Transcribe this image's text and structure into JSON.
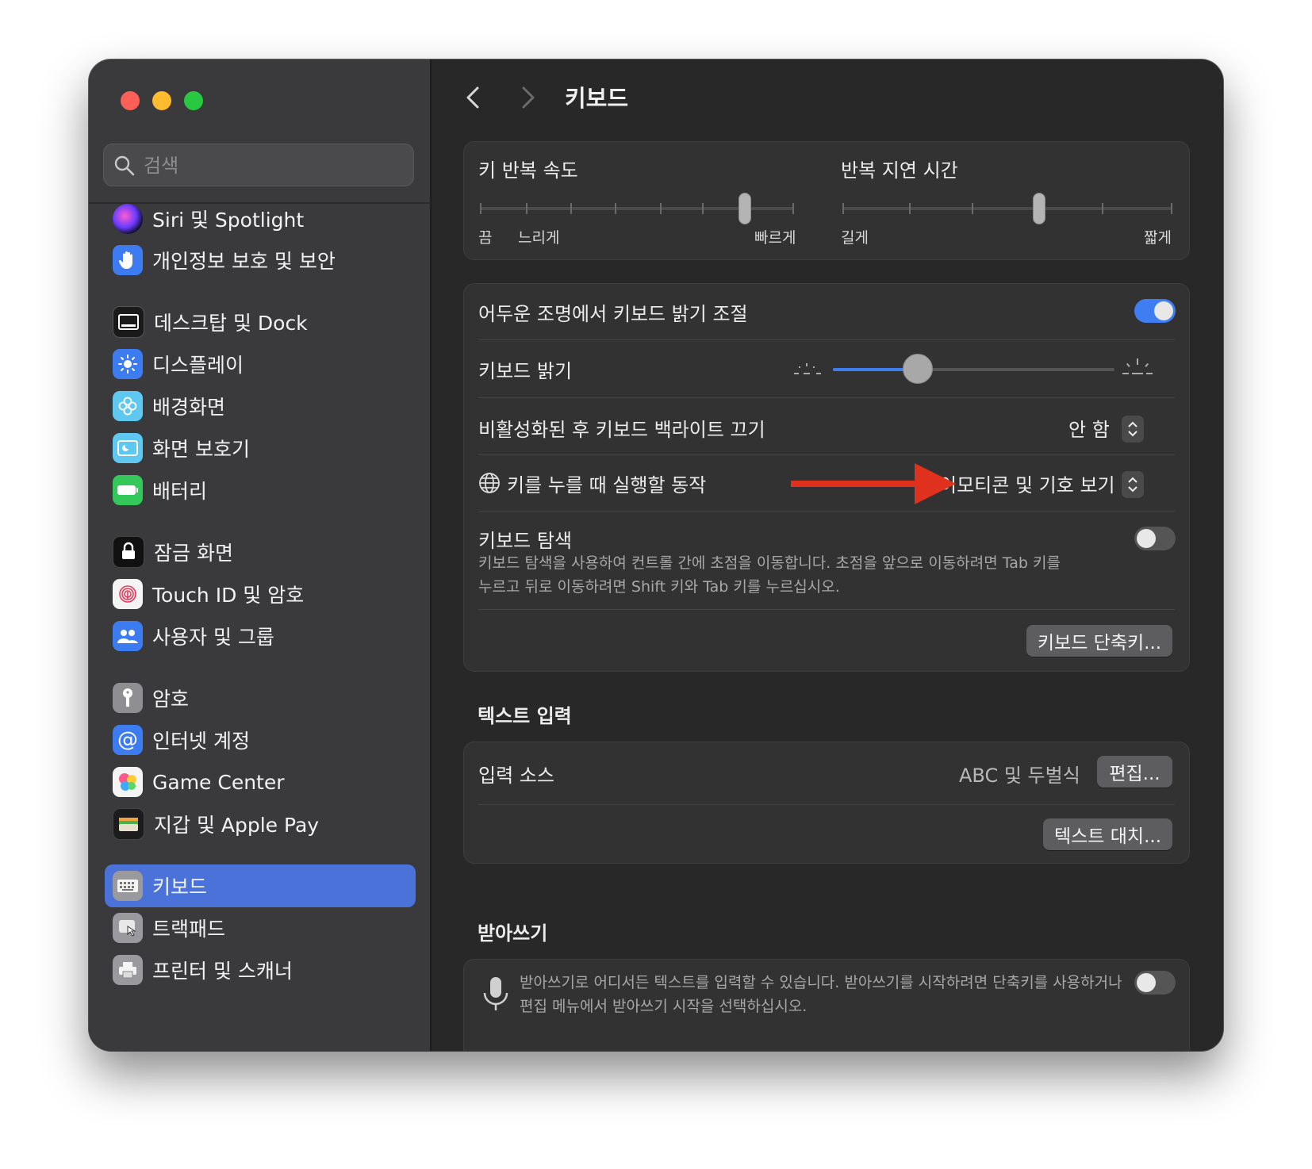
{
  "sidebar": {
    "search_placeholder": "검색",
    "items": [
      {
        "label": "Siri 및 Spotlight",
        "icon": "siri-icon"
      },
      {
        "label": "개인정보 보호 및 보안",
        "icon": "hand-icon"
      },
      {
        "label": "데스크탑 및 Dock",
        "icon": "dock-icon"
      },
      {
        "label": "디스플레이",
        "icon": "sun-icon"
      },
      {
        "label": "배경화면",
        "icon": "flower-icon"
      },
      {
        "label": "화면 보호기",
        "icon": "screensaver-icon"
      },
      {
        "label": "배터리",
        "icon": "battery-icon"
      },
      {
        "label": "잠금 화면",
        "icon": "lock-icon"
      },
      {
        "label": "Touch ID 및 암호",
        "icon": "fingerprint-icon"
      },
      {
        "label": "사용자 및 그룹",
        "icon": "users-icon"
      },
      {
        "label": "암호",
        "icon": "key-icon"
      },
      {
        "label": "인터넷 계정",
        "icon": "at-icon"
      },
      {
        "label": "Game Center",
        "icon": "game-center-icon"
      },
      {
        "label": "지갑 및 Apple Pay",
        "icon": "wallet-icon"
      },
      {
        "label": "키보드",
        "icon": "keyboard-icon",
        "selected": true
      },
      {
        "label": "트랙패드",
        "icon": "trackpad-icon"
      },
      {
        "label": "프린터 및 스캐너",
        "icon": "printer-icon"
      }
    ]
  },
  "header": {
    "title": "키보드"
  },
  "repeat": {
    "key_repeat_rate": {
      "title": "키 반복 속도",
      "left1": "끔",
      "left2": "느리게",
      "right": "빠르게",
      "value_fraction": 0.85
    },
    "repeat_delay": {
      "title": "반복 지연 시간",
      "left": "길게",
      "right": "짧게",
      "value_fraction": 0.6
    }
  },
  "keyboard": {
    "adjust_brightness_label": "어두운 조명에서 키보드 밝기 조절",
    "adjust_brightness_on": true,
    "brightness_label": "키보드 밝기",
    "brightness_fraction": 0.3,
    "backlight_off_label": "비활성화된 후 키보드 백라이트 끄기",
    "backlight_off_value": "안 함",
    "globe_key_label": "키를 누를 때 실행할 동작",
    "globe_key_value": "이모티콘 및 기호 보기",
    "navigation_label": "키보드 탐색",
    "navigation_desc_line1": "키보드 탐색을 사용하여 컨트롤 간에 초점을 이동합니다. 초점을 앞으로 이동하려면 Tab 키를",
    "navigation_desc_line2": "누르고 뒤로 이동하려면 Shift 키와 Tab 키를 누르십시오.",
    "navigation_on": false,
    "shortcuts_button": "키보드 단축키..."
  },
  "text_input": {
    "section_title": "텍스트 입력",
    "input_sources_label": "입력 소스",
    "input_sources_value": "ABC 및 두벌식",
    "edit_button": "편집...",
    "replacements_button": "텍스트 대치..."
  },
  "dictation": {
    "section_title": "받아쓰기",
    "desc_line1": "받아쓰기로 어디서든 텍스트를 입력할 수 있습니다. 받아쓰기를 시작하려면 단축키를 사용하거나",
    "desc_line2": "편집 메뉴에서 받아쓰기 시작을 선택하십시오.",
    "enabled": false
  },
  "colors": {
    "accent": "#4a72d9",
    "toggle_on": "#3f7ef2",
    "annotation_arrow": "#e0301e"
  }
}
